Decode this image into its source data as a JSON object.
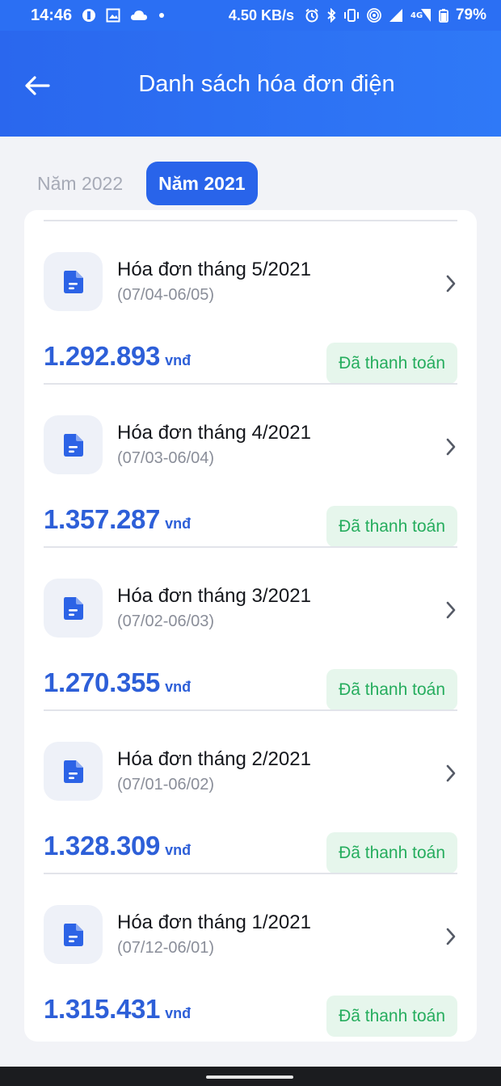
{
  "status_bar": {
    "time": "14:46",
    "speed": "4.50 KB/s",
    "battery": "79%",
    "icons": [
      "notification-icon",
      "image-icon",
      "cloud-icon",
      "dot-icon",
      "alarm-icon",
      "bluetooth-icon",
      "vibrate-icon",
      "hotspot-icon",
      "signal-icon",
      "4g-icon",
      "battery-icon"
    ]
  },
  "header": {
    "title": "Danh sách hóa đơn điện",
    "back_icon": "arrow-left-icon"
  },
  "tabs": [
    {
      "label": "Năm 2022",
      "active": false
    },
    {
      "label": "Năm 2021",
      "active": true
    }
  ],
  "bills": [
    {
      "title": "Hóa đơn tháng 5/2021",
      "period": "(07/04-06/05)",
      "amount": "1.292.893",
      "unit": "vnđ",
      "status": "Đã thanh toán"
    },
    {
      "title": "Hóa đơn tháng 4/2021",
      "period": "(07/03-06/04)",
      "amount": "1.357.287",
      "unit": "vnđ",
      "status": "Đã thanh toán"
    },
    {
      "title": "Hóa đơn tháng 3/2021",
      "period": "(07/02-06/03)",
      "amount": "1.270.355",
      "unit": "vnđ",
      "status": "Đã thanh toán"
    },
    {
      "title": "Hóa đơn tháng 2/2021",
      "period": "(07/01-06/02)",
      "amount": "1.328.309",
      "unit": "vnđ",
      "status": "Đã thanh toán"
    },
    {
      "title": "Hóa đơn tháng 1/2021",
      "period": "(07/12-06/01)",
      "amount": "1.315.431",
      "unit": "vnđ",
      "status": "Đã thanh toán"
    }
  ],
  "colors": {
    "primary": "#2964ea",
    "amount": "#2d5fd8",
    "paid_bg": "#e6f6ec",
    "paid_text": "#26ad5e"
  }
}
